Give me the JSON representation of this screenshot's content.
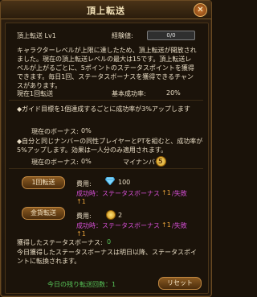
{
  "window": {
    "title": "頂上転送",
    "close_label": "✕"
  },
  "level": {
    "label": "頂上転送 Lv1",
    "exp_label": "経験値:",
    "exp_value": "0/0"
  },
  "description": "キャラクターレベルが上限に達したため、頂上転送が開放されました。現在の頂上転送レベルの最大は15です。頂上転送レベルが上がるごとに、5ポイントのステータスポイントを獲得できます。毎日1回、ステータスボーナスを獲得できるチャンスがあります。",
  "status": {
    "current_label": "現在1回転送",
    "rate_label": "基本成功率:",
    "rate_value": "20%"
  },
  "guide_note": "◆ガイド目標を1個達成するごとに成功率が3%アップします",
  "bonus1": {
    "label": "現在のボーナス:",
    "value": "0%"
  },
  "party_note": "◆自分と同じナンバーの同性プレイヤーとPTを組むと、成功率が5%アップします。効果は一人分のみ適用されます。",
  "bonus2": {
    "label": "現在のボーナス:",
    "value": "0%",
    "number_label": "マイナンバー:",
    "number_value": "5"
  },
  "transfer_gem": {
    "button_label": "1回転送",
    "cost_label": "費用:",
    "cost_value": "100",
    "success_text": "成功時：ステータスボーナス",
    "success_value": "↑1",
    "fail_text": "/失敗",
    "fail_value": "↑1"
  },
  "transfer_coin": {
    "button_label": "金貨転送",
    "cost_label": "費用:",
    "cost_value": "2",
    "success_text": "成功時：ステータスボーナス",
    "success_value": "↑1",
    "fail_text": "/失敗",
    "fail_value": "↑1"
  },
  "gained": {
    "label": "獲得したステータスボーナス:",
    "value": "0"
  },
  "notice": "今日獲得したステータスボーナスは明日以降、ステータスポイントに転換されます。",
  "footer": {
    "remaining": "今日の残り転送回数：1",
    "reset_label": "リセット"
  },
  "colors": {
    "accent": "#e7a13a",
    "magenta": "#d64fd6",
    "green": "#58c85a"
  }
}
